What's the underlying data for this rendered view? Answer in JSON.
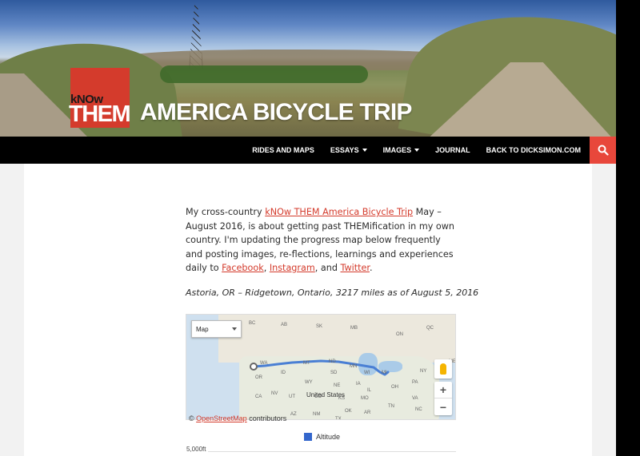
{
  "header": {
    "logo_small": "kNOw",
    "logo_large": "THEM",
    "title": "AMERICA BICYCLE TRIP"
  },
  "nav": {
    "items": [
      {
        "label": "RIDES AND MAPS",
        "dropdown": false
      },
      {
        "label": "ESSAYS",
        "dropdown": true
      },
      {
        "label": "IMAGES",
        "dropdown": true
      },
      {
        "label": "JOURNAL",
        "dropdown": false
      },
      {
        "label": "BACK TO DICKSIMON.COM",
        "dropdown": false
      }
    ],
    "search_icon": "search-icon"
  },
  "article": {
    "intro_1": "My cross-country ",
    "link_trip": "kNOw THEM America Bicycle Trip",
    "intro_2": " May – August 2016, is about getting past THEMification in my own country. I'm updating the progress map below frequently and posting images, re-flections, learnings and experiences daily to ",
    "link_facebook": "Facebook",
    "sep_1": ", ",
    "link_instagram": "Instagram",
    "sep_2": ",\nand ",
    "link_twitter": "Twitter",
    "end": ".",
    "caption": "Astoria, OR – Ridgetown, Ontario, 3217 miles as of August 5, 2016"
  },
  "map": {
    "type_select": "Map",
    "country_label": "United States",
    "state_labels": [
      "BC",
      "WA",
      "OR",
      "NV",
      "CA",
      "ID",
      "MT",
      "WY",
      "UT",
      "AZ",
      "NM",
      "CO",
      "ND",
      "SD",
      "NE",
      "KS",
      "OK",
      "TX",
      "MN",
      "IA",
      "MO",
      "WI",
      "MI",
      "IL",
      "OH",
      "PA",
      "NY",
      "ME",
      "ON",
      "QC",
      "AB",
      "SK",
      "MB",
      "VA",
      "NC",
      "TN",
      "AR"
    ],
    "zoom_in": "+",
    "zoom_out": "−",
    "attribution_prefix": "© ",
    "attribution_link": "OpenStreetMap",
    "attribution_suffix": " contributors"
  },
  "elevation_chart": {
    "legend": "Altitude",
    "y_label": "5,000ft",
    "series_color": "#3366cc"
  },
  "colors": {
    "accent": "#d43b2c",
    "search_bg": "#e8473b",
    "nav_bg": "#000000"
  }
}
